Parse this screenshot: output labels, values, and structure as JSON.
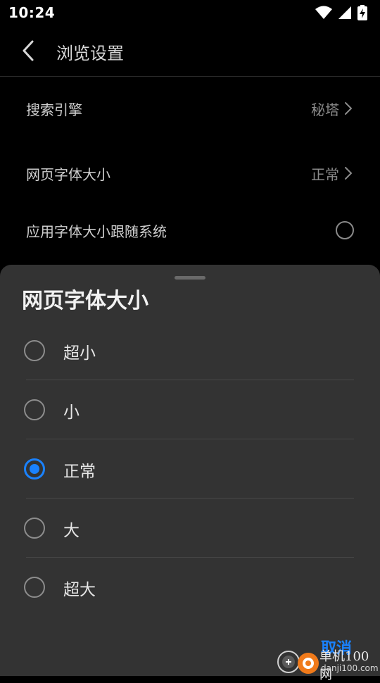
{
  "status_bar": {
    "time": "10:24"
  },
  "header": {
    "title": "浏览设置"
  },
  "settings": [
    {
      "label": "搜索引擎",
      "value": "秘塔",
      "kind": "link"
    },
    {
      "label": "网页字体大小",
      "value": "正常",
      "kind": "link"
    },
    {
      "label": "应用字体大小跟随系统",
      "kind": "toggle",
      "checked": false
    }
  ],
  "sheet": {
    "title": "网页字体大小",
    "options": [
      {
        "label": "超小",
        "selected": false
      },
      {
        "label": "小",
        "selected": false
      },
      {
        "label": "正常",
        "selected": true
      },
      {
        "label": "大",
        "selected": false
      },
      {
        "label": "超大",
        "selected": false
      }
    ],
    "cancel_label": "取消"
  },
  "watermark": {
    "name": "单机100网",
    "domain": "danji100.com"
  },
  "colors": {
    "accent": "#1a82ff",
    "background": "#000000",
    "sheet": "#333333"
  }
}
